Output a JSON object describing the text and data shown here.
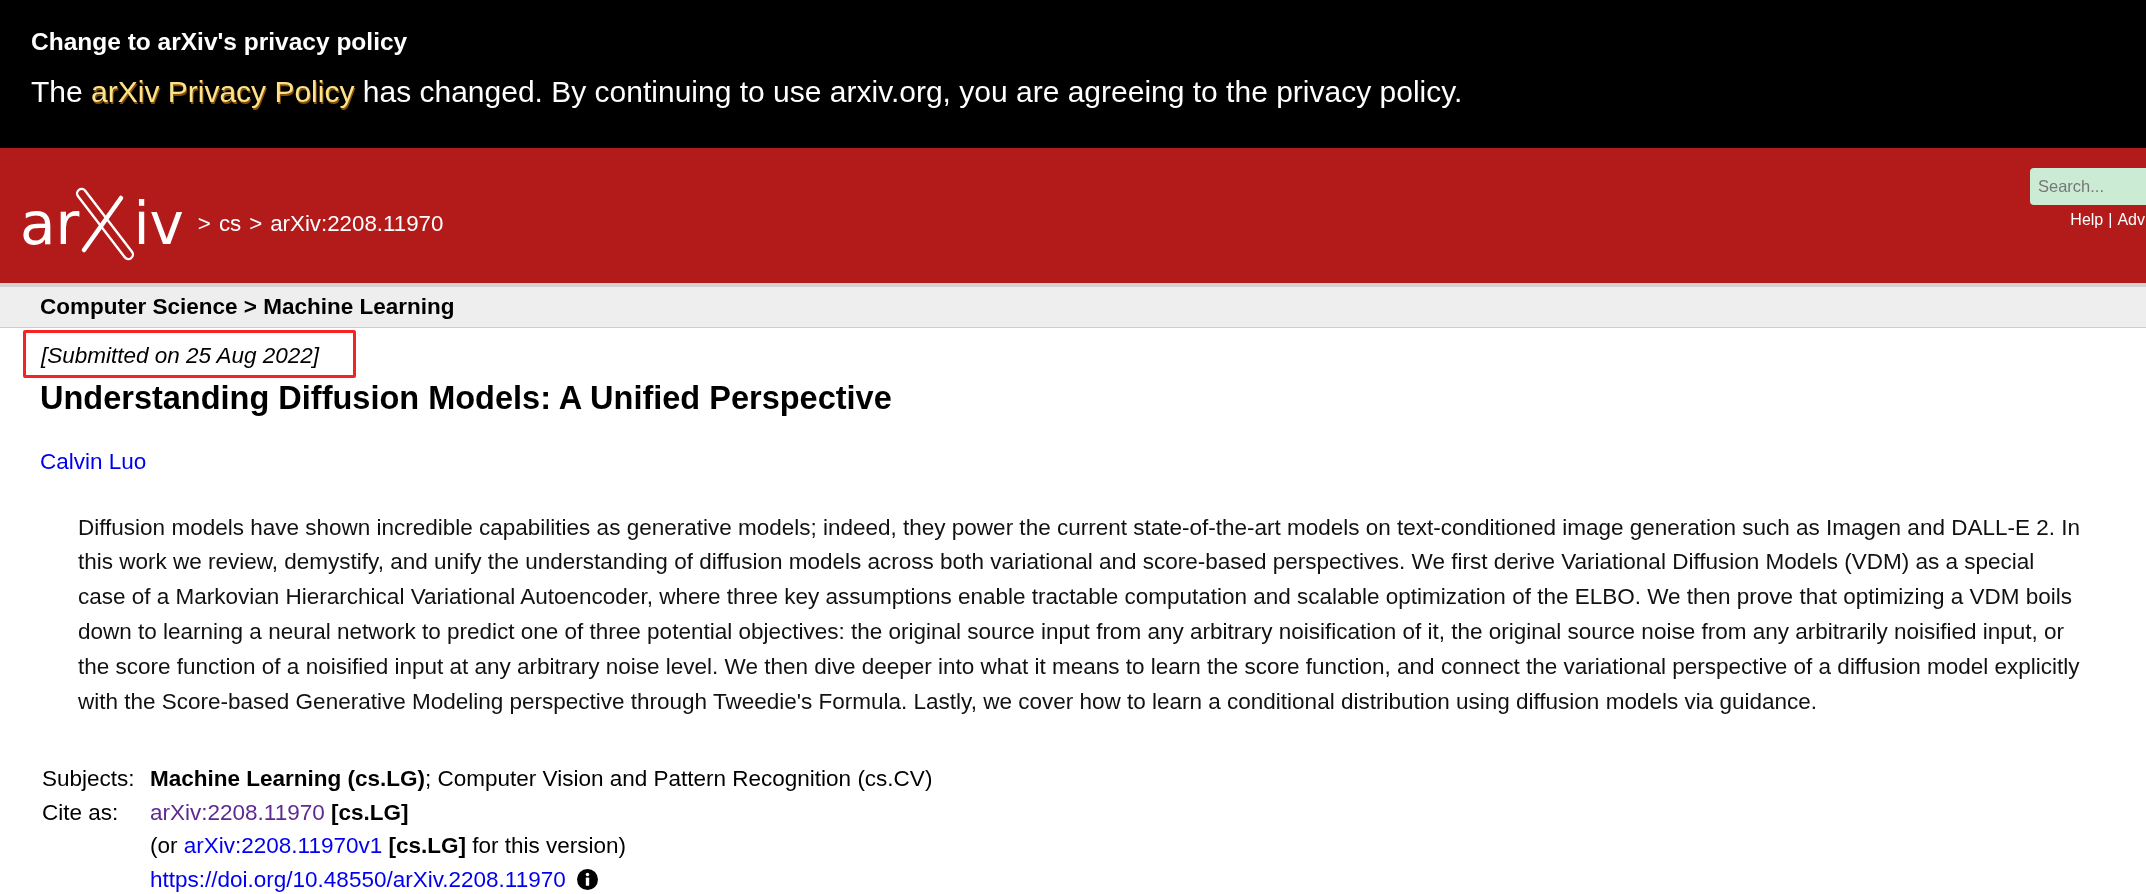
{
  "privacy_banner": {
    "title": "Change to arXiv's privacy policy",
    "message_before": "The",
    "link": "arXiv Privacy Policy",
    "message_after": "has changed. By continuing to use arxiv.org, you are agreeing to the privacy policy."
  },
  "header": {
    "logo": {
      "text_before_mark": "ar",
      "text_after_mark": "iv"
    },
    "breadcrumbs": [
      {
        "separator": ">",
        "text": "cs"
      },
      {
        "separator": ">",
        "text": "arXiv:2208.11970"
      }
    ],
    "search": {
      "placeholder": "Search..."
    },
    "help_links": [
      {
        "text": "Help"
      },
      {
        "separator": "|",
        "text": "Adv"
      }
    ]
  },
  "subject_bar": {
    "text": "Computer Science > Machine Learning"
  },
  "paper": {
    "submitted": {
      "text": "[Submitted on 25 Aug 2022]",
      "highlighted": true
    },
    "title": "Understanding Diffusion Models: A Unified Perspective",
    "authors": [
      {
        "name": "Calvin Luo"
      }
    ],
    "abstract": "Diffusion models have shown incredible capabilities as generative models; indeed, they power the current state-of-the-art models on text-conditioned image generation such as Imagen and DALL-E 2. In this work we review, demystify, and unify the understanding of diffusion models across both variational and score-based perspectives. We first derive Variational Diffusion Models (VDM) as a special case of a Markovian Hierarchical Variational Autoencoder, where three key assumptions enable tractable computation and scalable optimization of the ELBO. We then prove that optimizing a VDM boils down to learning a neural network to predict one of three potential objectives: the original source input from any arbitrary noisification of it, the original source noise from any arbitrarily noisified input, or the score function of a noisified input at any arbitrary noise level. We then dive deeper into what it means to learn the score function, and connect the variational perspective of a diffusion model explicitly with the Score-based Generative Modeling perspective through Tweedie's Formula. Lastly, we cover how to learn a conditional distribution using diffusion models via guidance.",
    "metadata": [
      {
        "kind": "text",
        "label": "Subjects:",
        "value": "**Machine Learning (cs.LG)**; Computer Vision and Pattern Recognition (cs.CV)"
      },
      {
        "kind": "link",
        "label": "Cite as:",
        "link": {
          "text": "arXiv:2208.11970",
          "visited": true
        },
        "after": "**[cs.LG]**"
      },
      {
        "kind": "link",
        "before": "(or",
        "link": {
          "text": "arXiv:2208.11970v1",
          "visited": false
        },
        "after": "**[cs.LG]** for this version)"
      },
      {
        "kind": "link_info",
        "link": {
          "text": "https://doi.org/10.48550/arXiv.2208.11970",
          "visited": false
        }
      }
    ]
  }
}
